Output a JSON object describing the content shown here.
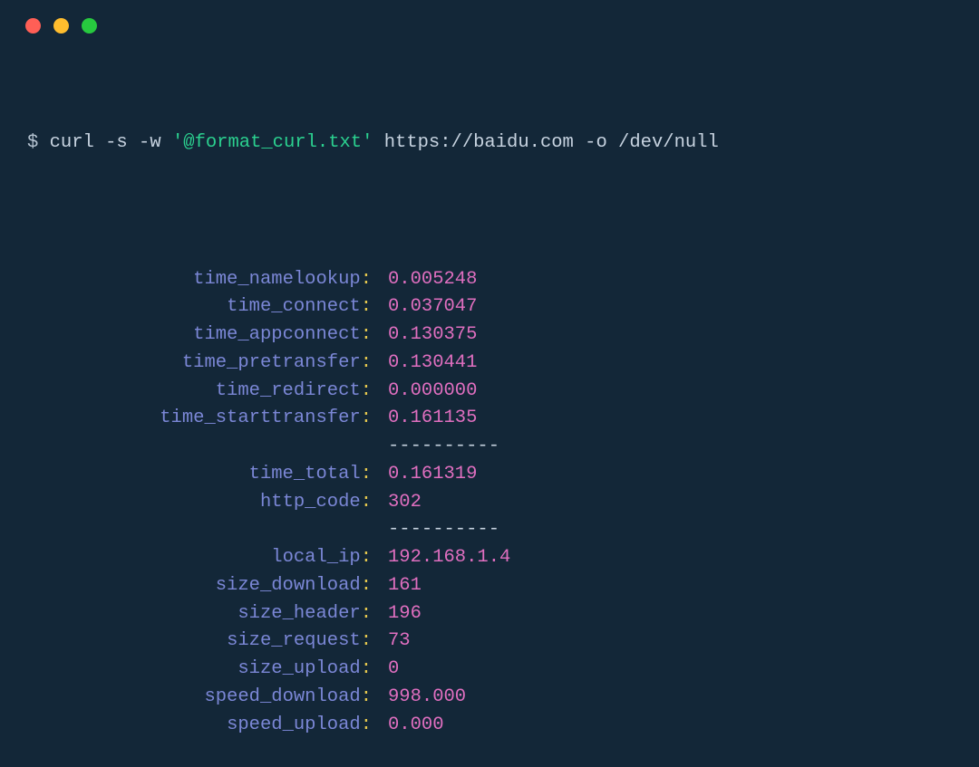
{
  "command": {
    "prompt": "$",
    "part1": "curl -s -w",
    "str": "'@format_curl.txt'",
    "part2": "https://baidu.com -o /dev/null"
  },
  "separator": "----------",
  "rows": [
    {
      "type": "kv",
      "key": "time_namelookup",
      "value": "0.005248"
    },
    {
      "type": "kv",
      "key": "time_connect",
      "value": "0.037047"
    },
    {
      "type": "kv",
      "key": "time_appconnect",
      "value": "0.130375"
    },
    {
      "type": "kv",
      "key": "time_pretransfer",
      "value": "0.130441"
    },
    {
      "type": "kv",
      "key": "time_redirect",
      "value": "0.000000"
    },
    {
      "type": "kv",
      "key": "time_starttransfer",
      "value": "0.161135"
    },
    {
      "type": "sep"
    },
    {
      "type": "kv",
      "key": "time_total",
      "value": "0.161319"
    },
    {
      "type": "kv",
      "key": "http_code",
      "value": "302"
    },
    {
      "type": "sep"
    },
    {
      "type": "kv",
      "key": "local_ip",
      "value": "192.168.1.4"
    },
    {
      "type": "kv",
      "key": "size_download",
      "value": "161"
    },
    {
      "type": "kv",
      "key": "size_header",
      "value": "196"
    },
    {
      "type": "kv",
      "key": "size_request",
      "value": "73"
    },
    {
      "type": "kv",
      "key": "size_upload",
      "value": "0"
    },
    {
      "type": "kv",
      "key": "speed_download",
      "value": "998.000"
    },
    {
      "type": "kv",
      "key": "speed_upload",
      "value": "0.000"
    }
  ]
}
